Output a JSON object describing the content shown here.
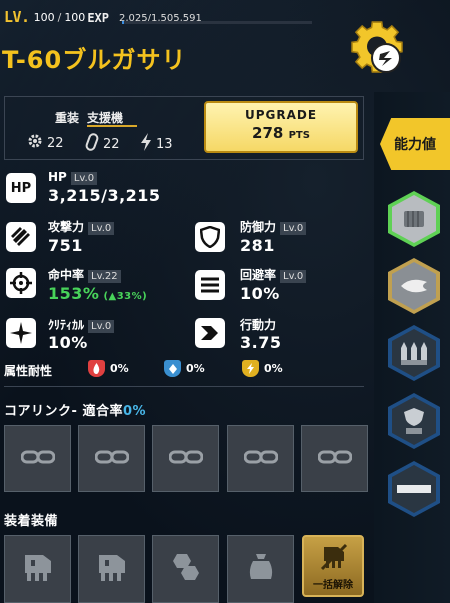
{
  "header": {
    "lv_label": "LV.",
    "lv_current": "100",
    "lv_sep": "/",
    "lv_max": "100",
    "exp_label": "EXP",
    "exp_value": "2,025/1,505,591",
    "exp_progress": 0.0013
  },
  "unit": {
    "name": "T-60ブルガサリ",
    "class_weight": "重装",
    "class_role": "支援機"
  },
  "mini_stats": {
    "gear": "22",
    "capsule": "22",
    "bolt": "13"
  },
  "upgrade": {
    "title": "UPGRADE",
    "points": "278",
    "unit": "PTS"
  },
  "stats": {
    "hp": {
      "icon_text": "HP",
      "label": "HP",
      "lv": "Lv.0",
      "value": "3,215/3,215"
    },
    "attack": {
      "label": "攻撃力",
      "lv": "Lv.0",
      "value": "751"
    },
    "defense": {
      "label": "防御力",
      "lv": "Lv.0",
      "value": "281"
    },
    "accuracy": {
      "label": "命中率",
      "lv": "Lv.22",
      "value": "153%",
      "bonus": "(▲33%)"
    },
    "evasion": {
      "label": "回避率",
      "lv": "Lv.0",
      "value": "10%"
    },
    "critical": {
      "label": "ｸﾘﾃｨｶﾙ",
      "lv": "Lv.0",
      "value": "10%"
    },
    "action": {
      "label": "行動力",
      "value": "3.75"
    }
  },
  "resistance": {
    "label": "属性耐性",
    "fire": "0%",
    "ice": "0%",
    "electric": "0%"
  },
  "core_link": {
    "label": "コアリンク-",
    "rate_label": "適合率",
    "rate": "0%"
  },
  "equipment": {
    "label": "装着装備",
    "unequip_all": "一括解除"
  },
  "right_tabs": {
    "active": "能力値"
  },
  "colors": {
    "accent": "#f2c62a",
    "green": "#48d35a",
    "cyan": "#48b6e8",
    "fire": "#e04040",
    "ice": "#3a8fd0",
    "electric": "#e0b020"
  }
}
